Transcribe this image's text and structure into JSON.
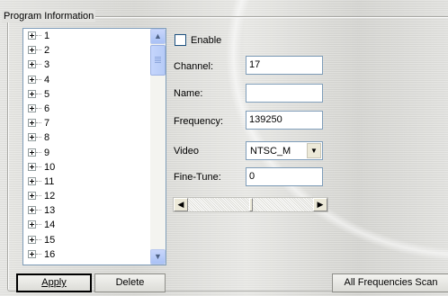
{
  "group": {
    "title": "Program Information"
  },
  "tree": {
    "items": [
      "1",
      "2",
      "3",
      "4",
      "5",
      "6",
      "7",
      "8",
      "9",
      "10",
      "11",
      "12",
      "13",
      "14",
      "15",
      "16"
    ]
  },
  "form": {
    "enable_label": "Enable",
    "enable_checked": false,
    "channel_label": "Channel:",
    "channel_value": "17",
    "name_label": "Name:",
    "name_value": "",
    "frequency_label": "Frequency:",
    "frequency_value": "139250",
    "video_label": "Video",
    "video_value": "NTSC_M",
    "finetune_label": "Fine-Tune:",
    "finetune_value": "0",
    "finetune_slider_fraction": 0.5
  },
  "buttons": {
    "apply": "Apply",
    "delete": "Delete",
    "scan": "All Frequencies Scan"
  }
}
